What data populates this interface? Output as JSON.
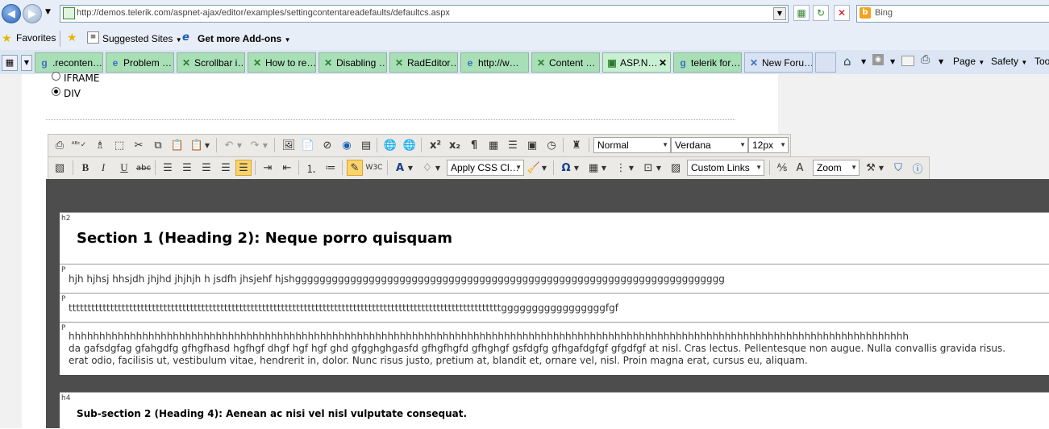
{
  "browser": {
    "url": "http://demos.telerik.com/aspnet-ajax/editor/examples/settingcontentareadefaults/defaultcs.aspx",
    "search_placeholder": "Bing",
    "favorites_label": "Favorites",
    "suggested_sites": "Suggested Sites",
    "addons": "Get more Add-ons",
    "tabs": [
      {
        "label": ".reconten…"
      },
      {
        "label": "Problem …"
      },
      {
        "label": "Scrollbar i…"
      },
      {
        "label": "How to re…"
      },
      {
        "label": "Disabling …"
      },
      {
        "label": "RadEditor…"
      },
      {
        "label": "http://w…"
      },
      {
        "label": "Content …"
      },
      {
        "label": "ASP.N…"
      },
      {
        "label": "telerik for…"
      },
      {
        "label": "New Foru…"
      }
    ],
    "commands": {
      "page": "Page",
      "safety": "Safety",
      "tools": "Too"
    }
  },
  "options": {
    "iframe_label": "IFRAME",
    "div_label": "DIV",
    "selected": "DIV"
  },
  "editor": {
    "format_block": "Normal",
    "font_name": "Verdana",
    "font_size": "12px",
    "apply_css": "Apply CSS Cl…",
    "custom_links": "Custom Links",
    "zoom": "Zoom"
  },
  "content": {
    "h2_tag": "h2",
    "h2_text": "Section 1 (Heading 2): Neque porro quisquam",
    "p_tag": "P",
    "p1": "hjh hjhsj hhsjdh jhjhd jhjhjh h jsdfh jhsjehf hjshgggggggggggggggggggggggggggggggggggggggggggggggggggggggggggggggggggggg",
    "p2": "ttttttttttttttttttttttttttttttttttttttttttttttttttttttttttttttttttttttttttttttttttttttttttttttttttttttttttttttttttgggggggggggggggggfgf",
    "p3_line1": "hhhhhhhhhhhhhhhhhhhhhhhhhhhhhhhhhhhhhhhhhhhhhhhhhhhhhhhhhhhhhhhhhhhhhhhhhhhhhhhhhhhhhhhhhhhhhhhhhhhhhhhhhhhhhhhhhhhhhhhhhhhhhhhhhhhhhhhhh",
    "p3_line2": "da gafsdgfag gfahgdfg gfhgfhasd hgfhgf dhgf hgf hgf ghd gfgghghgasfd gfhgfhgfd gfhghgf gsfdgfg gfhgafdgfgf gfgdfgf at nisl. Cras lectus. Pellentesque non augue. Nulla convallis gravida risus.",
    "p3_line3": "erat odio, facilisis ut, vestibulum vitae, hendrerit in, dolor. Nunc risus justo, pretium at, blandit et, ornare vel, nisl. Proin magna erat, cursus eu, aliquam.",
    "h4_tag": "h4",
    "h4_text": "Sub-section 2 (Heading 4): Aenean ac nisi vel nisl vulputate consequat."
  }
}
